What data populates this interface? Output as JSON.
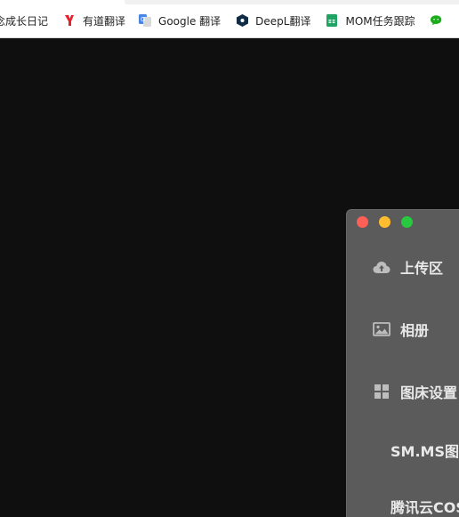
{
  "bookmarks": [
    {
      "label": "念成长日记",
      "icon": "bookmark-icon"
    },
    {
      "label": "有道翻译",
      "icon": "youdao-icon"
    },
    {
      "label": "Google 翻译",
      "icon": "google-translate-icon"
    },
    {
      "label": "DeepL翻译",
      "icon": "deepl-icon"
    },
    {
      "label": "MOM任务跟踪",
      "icon": "sheets-icon"
    },
    {
      "label": "",
      "icon": "wechat-icon"
    }
  ],
  "window": {
    "nav": [
      {
        "label": "上传区",
        "icon": "cloud-upload-icon"
      },
      {
        "label": "相册",
        "icon": "image-icon"
      },
      {
        "label": "图床设置",
        "icon": "grid-icon"
      }
    ],
    "sub_items": [
      "SM.MS图床",
      "腾讯云COS"
    ]
  },
  "colors": {
    "page_background": "#0f0f0f",
    "window_background": "#5b5b5b",
    "close": "#fe5f57",
    "minimize": "#febc2e",
    "maximize": "#28c840"
  }
}
